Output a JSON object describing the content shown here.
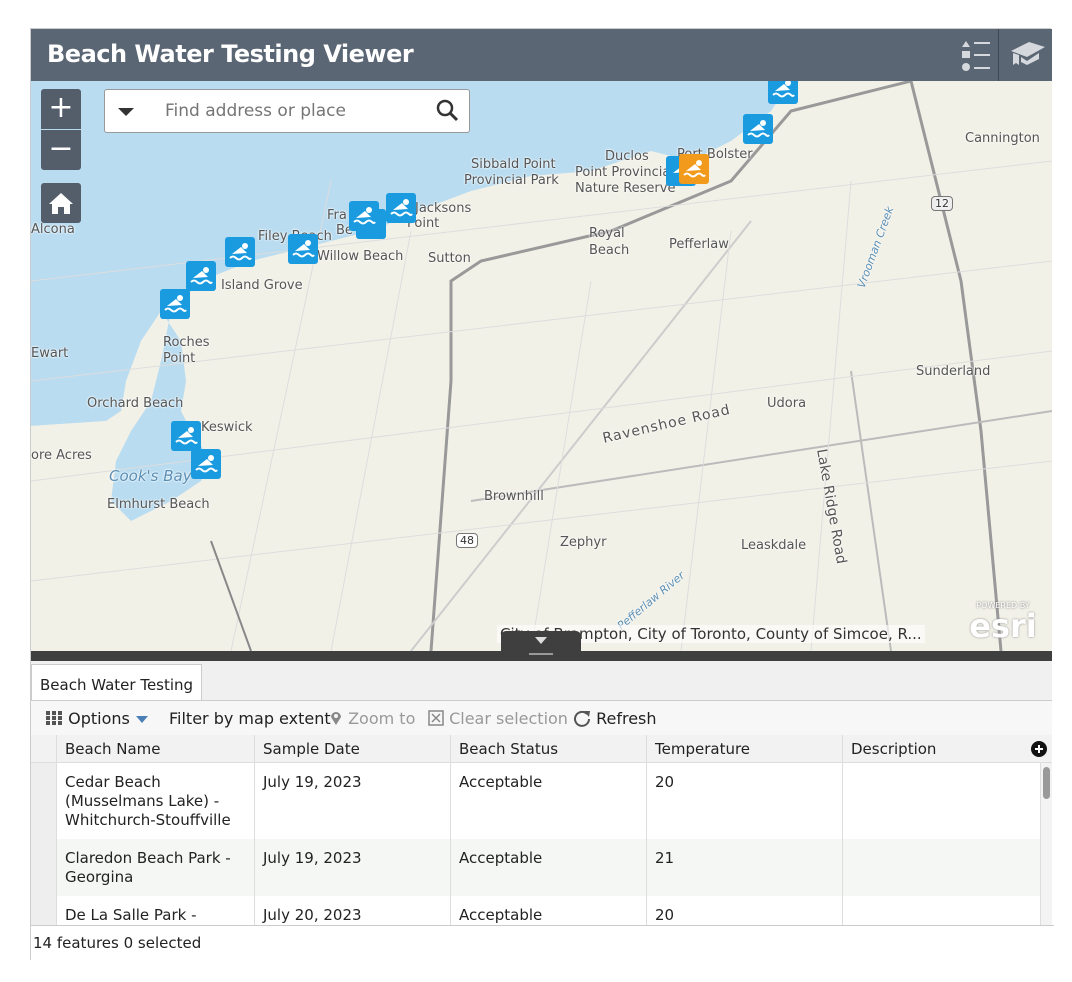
{
  "header": {
    "title": "Beach Water Testing Viewer",
    "icons": [
      "legend-icon",
      "about-icon"
    ]
  },
  "map": {
    "search_placeholder": "Find address or place",
    "zoom_in": "+",
    "zoom_out": "−",
    "attribution": "City of Brampton, City of Toronto, County of Simcoe, R...",
    "logo": "POWERED BY esri",
    "labels": [
      "Sibbald Point",
      "Provincial Park",
      "Duclos",
      "Point Provincial",
      "Nature Reserve",
      "Port Bolster",
      "Cannington",
      "Jacksons",
      "Point",
      "Fra",
      "Be",
      "Filey Beach",
      "Willow Beach",
      "Sutton",
      "Royal",
      "Beach",
      "Pefferlaw",
      "Alcona",
      "Island Grove",
      "Roches",
      "Point",
      "Ewart",
      "Orchard Beach",
      "Keswick",
      "ore Acres",
      "Cook's Bay",
      "Elmhurst Beach",
      "Ravenshoe Road",
      "Udora",
      "Lake Ridge Road",
      "Sunderland",
      "Brownhill",
      "Zephyr",
      "Leaskdale",
      "Pefferlaw River",
      "Vrooman Creek",
      "12",
      "48"
    ],
    "colors": {
      "water": "#b9dcf0",
      "marker": "#1a9be0",
      "marker_alt": "#f29a1b"
    }
  },
  "panel": {
    "tab": "Beach Water Testing",
    "toolbar": {
      "options": "Options",
      "filter": "Filter by map extent",
      "zoom_to": "Zoom to",
      "clear": "Clear selection",
      "refresh": "Refresh"
    },
    "columns": [
      "Beach Name",
      "Sample Date",
      "Beach Status",
      "Temperature",
      "Description"
    ],
    "rows": [
      {
        "name": "Cedar Beach (Musselmans Lake) - Whitchurch-Stouffville",
        "date": "July 19, 2023",
        "status": "Acceptable",
        "temp": "20",
        "desc": ""
      },
      {
        "name": "Claredon Beach Park - Georgina",
        "date": "July 19, 2023",
        "status": "Acceptable",
        "temp": "21",
        "desc": ""
      },
      {
        "name": "De La Salle Park -",
        "date": "July 20, 2023",
        "status": "Acceptable",
        "temp": "20",
        "desc": ""
      }
    ],
    "footer": "14 features 0 selected"
  }
}
